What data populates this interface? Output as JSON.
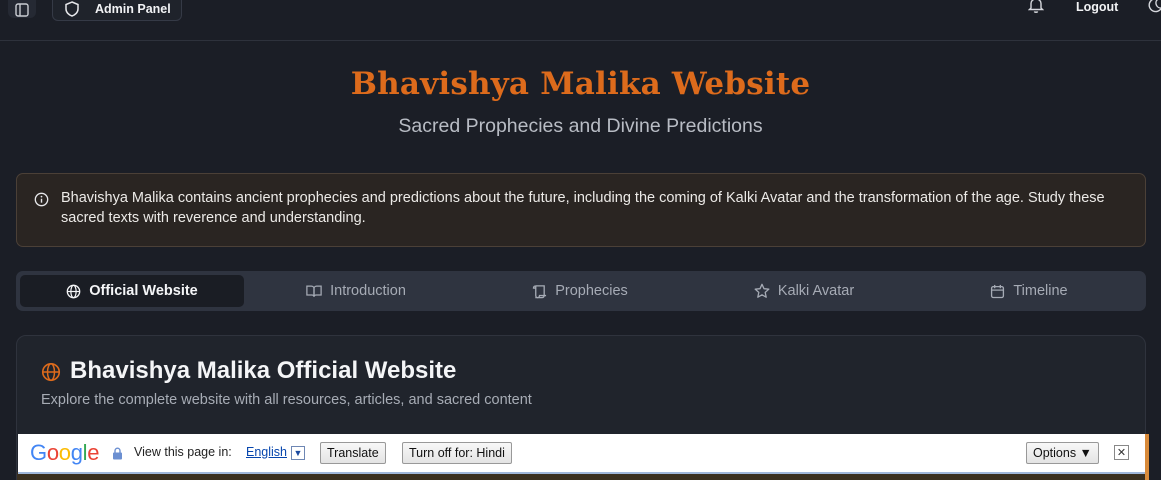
{
  "topbar": {
    "admin_label": "Admin Panel",
    "logout_label": "Logout"
  },
  "header": {
    "title": "Bhavishya Malika Website",
    "subtitle": "Sacred Prophecies and Divine Predictions"
  },
  "alert": {
    "text": "Bhavishya Malika contains ancient prophecies and predictions about the future, including the coming of Kalki Avatar and the transformation of the age. Study these sacred texts with reverence and understanding."
  },
  "tabs": [
    {
      "label": "Official Website",
      "icon": "globe-icon",
      "active": true
    },
    {
      "label": "Introduction",
      "icon": "book-icon",
      "active": false
    },
    {
      "label": "Prophecies",
      "icon": "scroll-icon",
      "active": false
    },
    {
      "label": "Kalki Avatar",
      "icon": "star-icon",
      "active": false
    },
    {
      "label": "Timeline",
      "icon": "calendar-icon",
      "active": false
    }
  ],
  "card": {
    "title": "Bhavishya Malika Official Website",
    "description": "Explore the complete website with all resources, articles, and sacred content"
  },
  "translate_bar": {
    "logo": "Google",
    "prompt": "View this page in:",
    "language": "English",
    "translate_label": "Translate",
    "turn_off_label": "Turn off for: Hindi",
    "options_label": "Options ▼",
    "close_glyph": "✕"
  },
  "colors": {
    "accent": "#dd6b1c",
    "background": "#1b1e26",
    "active_tab": "#1a1d24"
  }
}
